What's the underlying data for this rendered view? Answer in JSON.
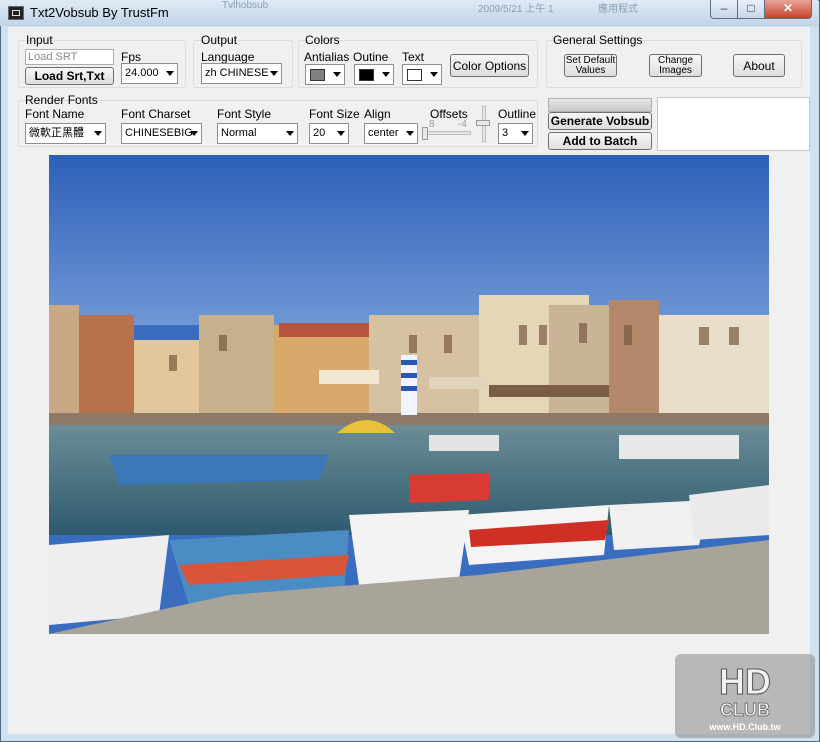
{
  "window": {
    "title": "Txt2Vobsub By TrustFm",
    "background_titles": [
      "Tvlhobsub",
      "2009/5/21 上午 1",
      "應用程式"
    ],
    "controls": {
      "minimize": "–",
      "maximize": "□",
      "close": "✕"
    }
  },
  "input": {
    "group_label": "Input",
    "srt_placeholder": "Load SRT",
    "load_button": "Load Srt,Txt",
    "fps_label": "Fps",
    "fps_value": "24.000"
  },
  "output": {
    "group_label": "Output",
    "language_label": "Language",
    "language_value": "zh CHINESE"
  },
  "colors": {
    "group_label": "Colors",
    "antialias_label": "Antialias",
    "outline_label": "Outine",
    "text_label": "Text",
    "antialias_color": "#808080",
    "outline_color": "#000000",
    "text_color": "#ffffff",
    "options_button": "Color Options"
  },
  "general": {
    "group_label": "General Settings",
    "set_default_button": "Set Default Values",
    "change_images_button": "Change Images",
    "about_button": "About"
  },
  "render": {
    "group_label": "Render Fonts",
    "font_name_label": "Font Name",
    "font_name_value": "微軟正黑體",
    "font_charset_label": "Font Charset",
    "font_charset_value": "CHINESEBIG",
    "font_style_label": "Font Style",
    "font_style_value": "Normal",
    "font_size_label": "Font Size",
    "font_size_value": "20",
    "align_label": "Align",
    "align_value": "center",
    "offsets_label": "Offsets",
    "offset_x": "8",
    "offset_y": "-4",
    "outline_label": "Outline",
    "outline_value": "3"
  },
  "actions": {
    "generate_button": "Generate Vobsub",
    "batch_button": "Add to Batch"
  },
  "watermark": {
    "logo_text": "HD CLUB",
    "url": "www.HD.Club.tw"
  },
  "colors_palette": {
    "sky": "#3b6fc4",
    "sea": "#3e6f86",
    "ground": "#a8a49a"
  }
}
